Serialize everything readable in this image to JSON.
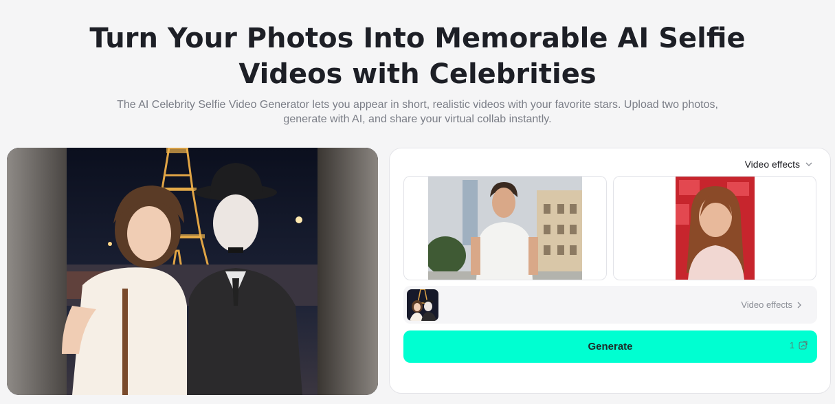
{
  "hero": {
    "title_line1": "Turn Your Photos Into Memorable AI Selfie",
    "title_line2": "Videos with Celebrities",
    "subtitle_line1": "The AI Celebrity Selfie Video Generator lets you appear in short, realistic videos with your favorite stars. Upload two photos,",
    "subtitle_line2": "generate with AI, and share your virtual collab instantly."
  },
  "preview": {
    "image": "selfie-eiffel-tower-couple"
  },
  "panel": {
    "effects_dropdown_label": "Video effects",
    "uploads": [
      {
        "image": "man-white-tshirt-photo"
      },
      {
        "image": "woman-celebrity-photo"
      }
    ],
    "effects_row": {
      "label": "Video effects",
      "thumbnail": "eiffel-selfie-thumbnail"
    },
    "generate": {
      "label": "Generate",
      "credits": "1"
    }
  },
  "colors": {
    "accent": "#00ffd1",
    "background": "#f5f5f6",
    "title": "#1d1f26",
    "subtitle": "#7b7e87"
  }
}
